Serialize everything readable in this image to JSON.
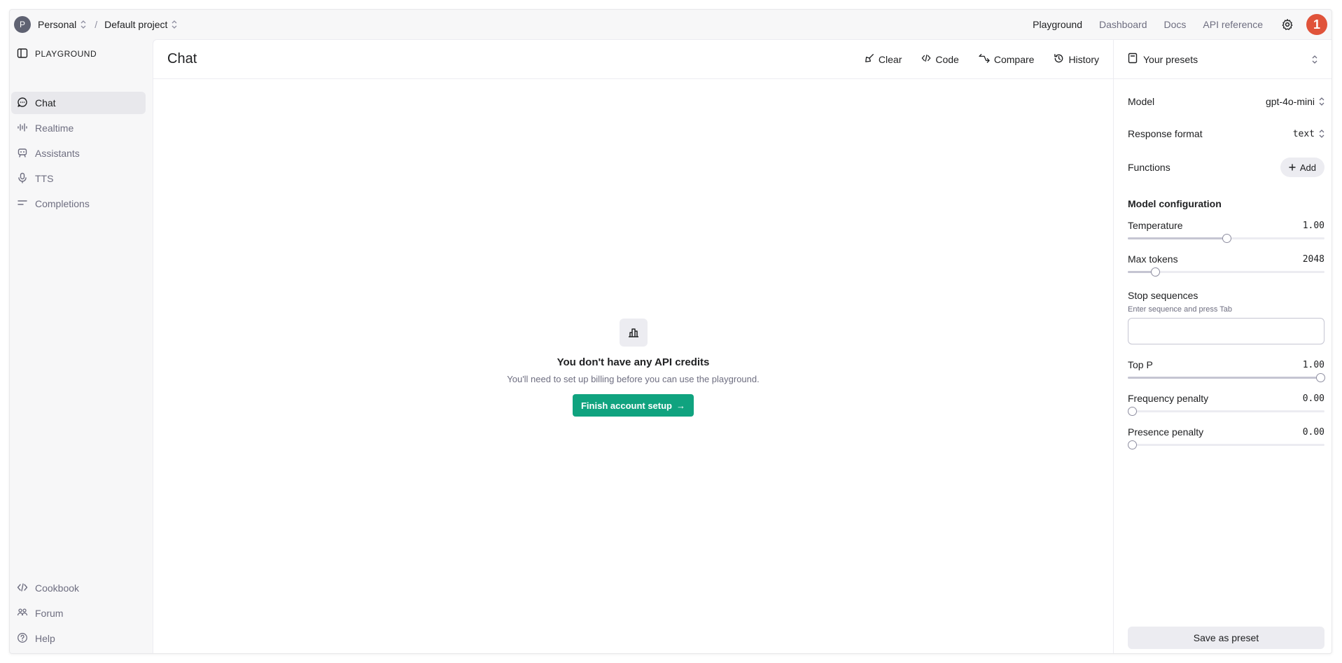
{
  "topbar": {
    "org_initial": "P",
    "org_name": "Personal",
    "project_name": "Default project",
    "separator": "/",
    "nav": [
      "Playground",
      "Dashboard",
      "Docs",
      "API reference"
    ],
    "active_nav": "Playground",
    "user_badge": "1"
  },
  "sidebar": {
    "title": "PLAYGROUND",
    "items": [
      {
        "label": "Chat",
        "icon": "chat-bubble-icon"
      },
      {
        "label": "Realtime",
        "icon": "waveform-icon"
      },
      {
        "label": "Assistants",
        "icon": "robot-icon"
      },
      {
        "label": "TTS",
        "icon": "microphone-icon"
      },
      {
        "label": "Completions",
        "icon": "lines-icon"
      }
    ],
    "footer": [
      {
        "label": "Cookbook",
        "icon": "code-icon"
      },
      {
        "label": "Forum",
        "icon": "people-icon"
      },
      {
        "label": "Help",
        "icon": "help-icon"
      }
    ]
  },
  "main": {
    "title": "Chat",
    "actions": [
      {
        "label": "Clear",
        "icon": "broom-icon"
      },
      {
        "label": "Code",
        "icon": "code-icon"
      },
      {
        "label": "Compare",
        "icon": "compare-icon"
      },
      {
        "label": "History",
        "icon": "history-icon"
      }
    ],
    "empty_state": {
      "title": "You don't have any API credits",
      "subtitle": "You'll need to set up billing before you can use the playground.",
      "button": "Finish account setup",
      "arrow": "→"
    }
  },
  "panel": {
    "presets_label": "Your presets",
    "model_label": "Model",
    "model_value": "gpt-4o-mini",
    "response_format_label": "Response format",
    "response_format_value": "text",
    "functions_label": "Functions",
    "add_label": "Add",
    "config_label": "Model configuration",
    "temperature_label": "Temperature",
    "temperature_value": "1.00",
    "temperature_fraction": 0.5,
    "max_tokens_label": "Max tokens",
    "max_tokens_value": "2048",
    "max_tokens_fraction": 0.14,
    "stop_label": "Stop sequences",
    "stop_hint": "Enter sequence and press Tab",
    "stop_value": "",
    "top_p_label": "Top P",
    "top_p_value": "1.00",
    "top_p_fraction": 1.0,
    "freq_label": "Frequency penalty",
    "freq_value": "0.00",
    "freq_fraction": 0.0,
    "presence_label": "Presence penalty",
    "presence_value": "0.00",
    "presence_fraction": 0.0,
    "save_label": "Save as preset"
  }
}
